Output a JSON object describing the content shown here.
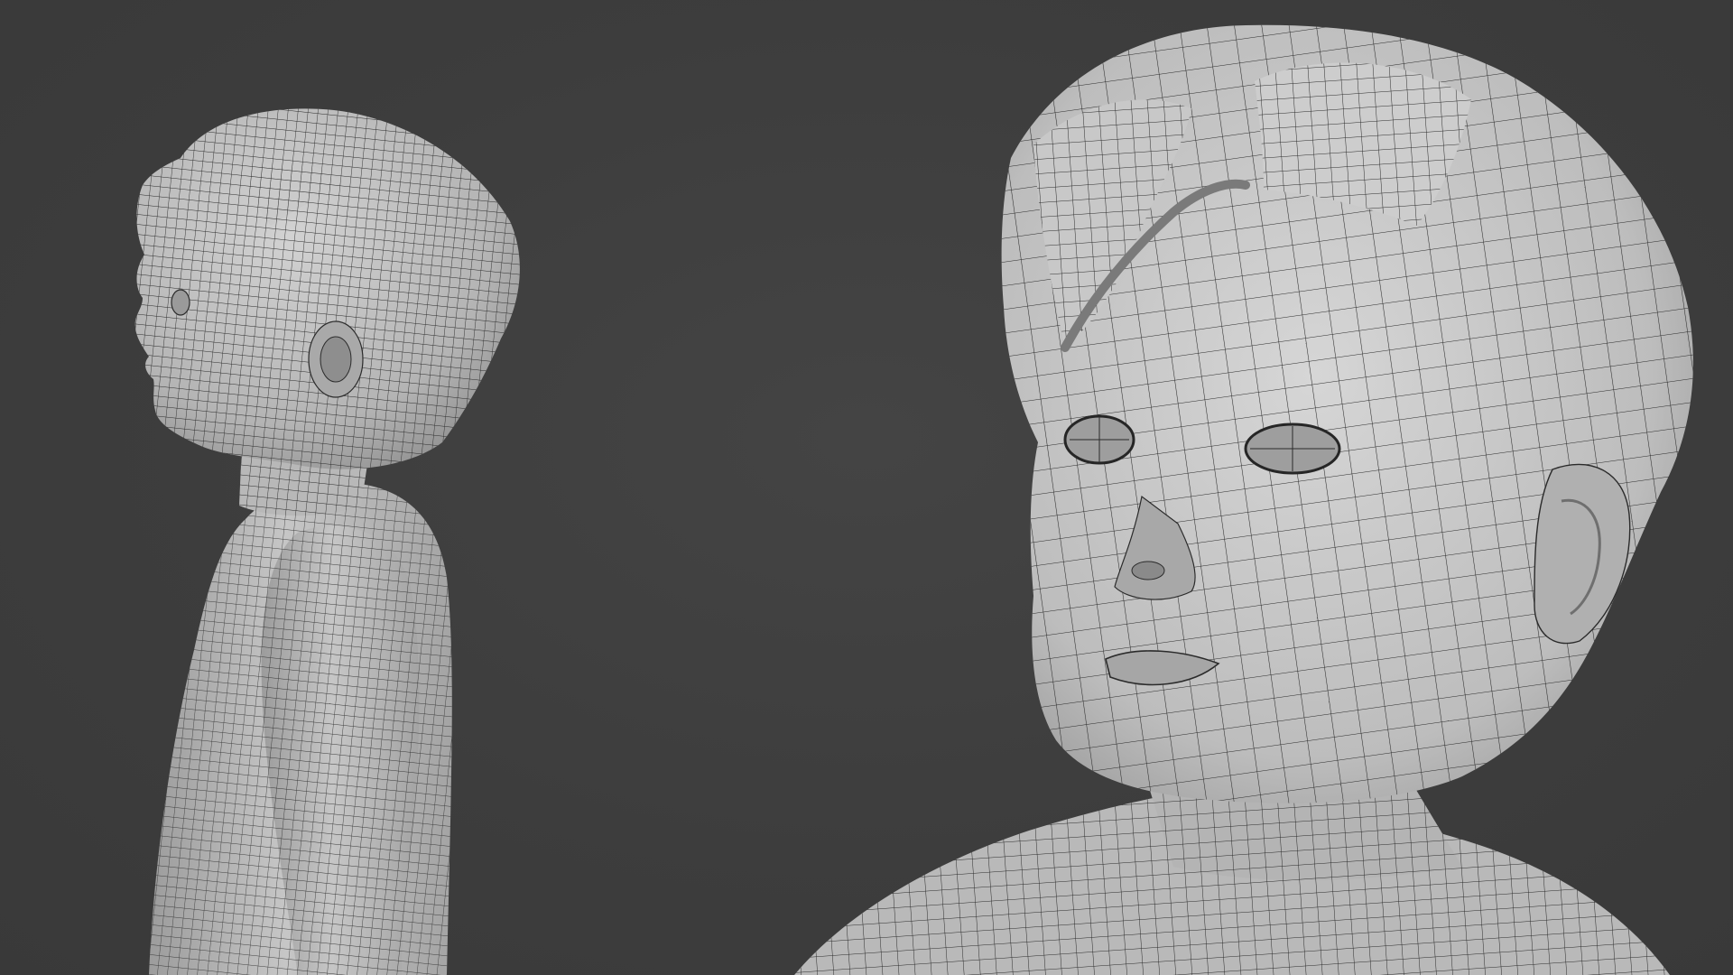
{
  "scene": {
    "background_color": "#3d3d3d",
    "mesh_fill_color": "#bcbcbc",
    "mesh_shadow_color": "#8d8d8d",
    "wire_color": "#2b2b2b",
    "views": [
      {
        "name": "profile-view",
        "subject": "child-character-side-profile"
      },
      {
        "name": "closeup-view",
        "subject": "child-character-face-three-quarter"
      }
    ]
  }
}
